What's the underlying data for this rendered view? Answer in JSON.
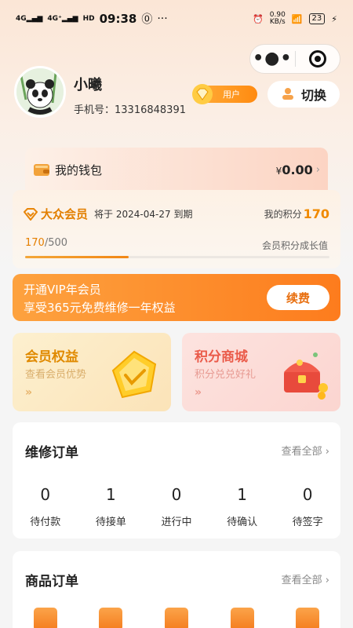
{
  "status_bar": {
    "network_left": "4G",
    "network_right": "4G⁺",
    "hd": "HD",
    "time": "09:38",
    "speed_value": "0.90",
    "speed_unit": "KB/s",
    "battery": "23"
  },
  "header": {
    "more_glyph": "•●•"
  },
  "user": {
    "name": "小曦",
    "phone_label": "手机号：",
    "phone": "13316848391",
    "role": "用户",
    "switch_label": "切换"
  },
  "wallet": {
    "label": "我的钱包",
    "currency": "¥",
    "amount": "0.00"
  },
  "membership": {
    "level": "大众会员",
    "expire_prefix": "将于",
    "expire_date": "2024-04-27",
    "expire_suffix": "到期",
    "points_label": "我的积分",
    "points": "170",
    "progress_current": "170",
    "progress_total": "/500",
    "progress_fraction": 0.34,
    "growth_label": "会员积分成长值"
  },
  "vip_banner": {
    "line1": "开通VIP年会员",
    "line2": "享受365元免费维修一年权益",
    "button": "续费"
  },
  "tiles": {
    "benefits": {
      "title": "会员权益",
      "subtitle": "查看会员优势",
      "arrow": "»"
    },
    "mall": {
      "title": "积分商城",
      "subtitle": "积分兑兑好礼",
      "arrow": "»"
    }
  },
  "repair_orders": {
    "title": "维修订单",
    "view_all": "查看全部",
    "stats": [
      {
        "count": "0",
        "label": "待付款"
      },
      {
        "count": "1",
        "label": "待接单"
      },
      {
        "count": "0",
        "label": "进行中"
      },
      {
        "count": "1",
        "label": "待确认"
      },
      {
        "count": "0",
        "label": "待签字"
      }
    ]
  },
  "goods_orders": {
    "title": "商品订单",
    "view_all": "查看全部",
    "icons": [
      "wallet-icon",
      "box-icon",
      "bag-icon",
      "chat-icon",
      "pen-icon"
    ]
  },
  "colors": {
    "accent": "#f08a00",
    "vip_banner": "#fd7c1d",
    "mall_title": "#ea5b4a"
  }
}
